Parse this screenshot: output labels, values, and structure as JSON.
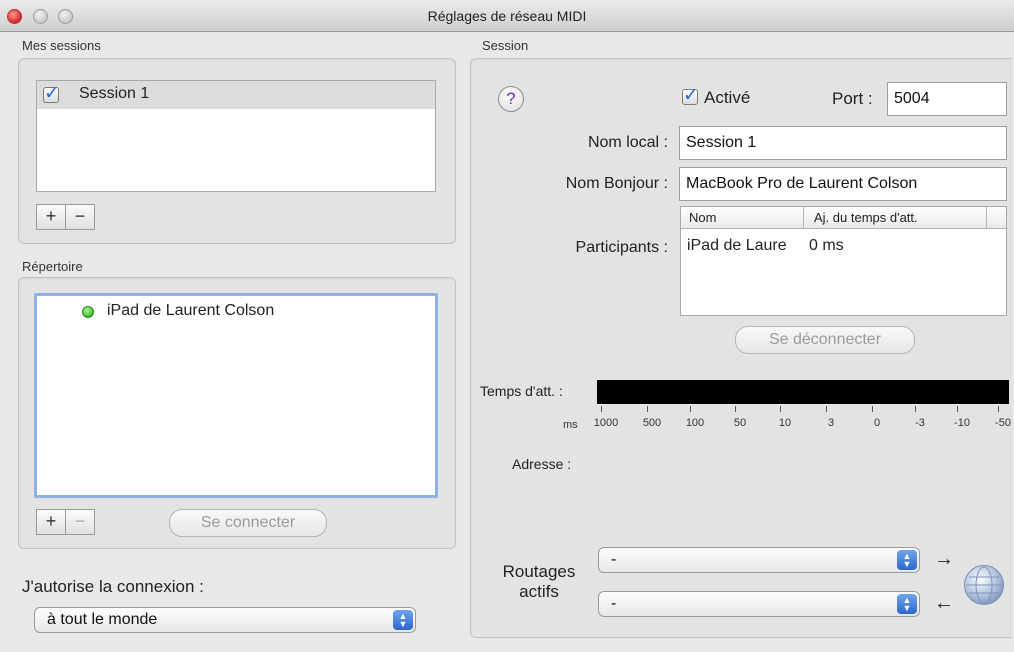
{
  "window": {
    "title": "Réglages de réseau MIDI"
  },
  "sessions": {
    "group_label": "Mes sessions",
    "items": [
      {
        "label": "Session 1",
        "checked": true
      }
    ],
    "add_label": "+",
    "remove_label": "−"
  },
  "directory": {
    "group_label": "Répertoire",
    "items": [
      {
        "label": "iPad de Laurent Colson",
        "status": "online"
      }
    ],
    "add_label": "+",
    "remove_label": "−",
    "connect_label": "Se connecter"
  },
  "permission": {
    "label": "J'autorise la connexion :",
    "selected": "à tout le monde"
  },
  "session": {
    "group_label": "Session",
    "help_label": "?",
    "enabled_label": "Activé",
    "enabled": true,
    "port_label": "Port :",
    "port_value": "5004",
    "local_name_label": "Nom local :",
    "local_name_value": "Session 1",
    "bonjour_name_label": "Nom Bonjour :",
    "bonjour_name_value": "MacBook Pro de Laurent Colson",
    "participants_label": "Participants :",
    "participants_columns": [
      "Nom",
      "Aj. du temps d'att."
    ],
    "participants_rows": [
      {
        "name": "iPad de Laure",
        "latency": "0 ms"
      }
    ],
    "disconnect_label": "Se déconnecter",
    "latency_label": "Temps d'att. :",
    "latency_unit": "ms",
    "latency_ticks": [
      "1000",
      "500",
      "100",
      "50",
      "10",
      "3",
      "0",
      "-3",
      "-10",
      "-50"
    ],
    "address_label": "Adresse :",
    "routing_label_line1": "Routages",
    "routing_label_line2": "actifs",
    "routing_out_value": "-",
    "routing_in_value": "-"
  },
  "colors": {
    "accent": "#2c67cf",
    "status_online": "#3cbf2a",
    "focus_ring": "#8db2e3"
  },
  "icons": {
    "arrow_right": "→",
    "arrow_left": "←",
    "network": "globe-icon"
  }
}
